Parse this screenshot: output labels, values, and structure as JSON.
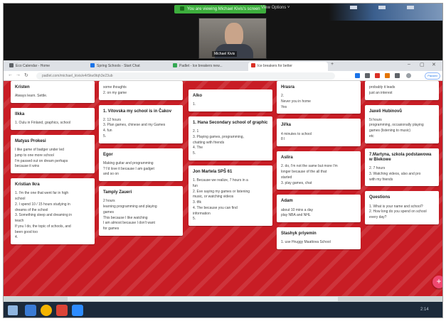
{
  "zoom": {
    "share_status": "You are viewing Michael Kivis's screen",
    "view_options": "View Options ˅",
    "participant_name": "Michael Kivis"
  },
  "browser": {
    "tabs": [
      {
        "label": "Eco Calendar - Home",
        "color": "#5f6368"
      },
      {
        "label": "Spring Schools - Start Chat",
        "color": "#1a73e8"
      },
      {
        "label": "Padlet - Ice breakers new...",
        "color": "#34a853"
      },
      {
        "label": "Ice breakers for better",
        "color": "#d93025"
      }
    ],
    "new_tab": "+",
    "url": "padlet.com/michael_kivis/e4r5kw9tqh3e23ub",
    "profile_label": "Paused",
    "extension_colors": [
      "#1a73e8",
      "#5f6368",
      "#d93025",
      "#e37400",
      "#5f6368"
    ]
  },
  "columns": [
    {
      "cards": [
        {
          "title": "Kristen",
          "lines": [
            "Always learn. Settle."
          ]
        },
        {
          "title": "Ilkka",
          "lines": [
            "1. Oulu in Finland, graphics, school"
          ]
        },
        {
          "title": "Matyas Prokesi",
          "lines": [
            "I like game of badger under led",
            "jump to one more school",
            "I'm passed out on dream perhaps",
            "because it wins"
          ]
        },
        {
          "title": "Kristian Ikra",
          "lines": [
            "1. I'm the one that went far in high",
            "school",
            "2. I spend 10 / 15 hours studying in",
            "dreams of the school",
            "3. Something sleep and dreaming in",
            "teach",
            "If you I do, the topic of schools, and",
            "been good too",
            "4."
          ]
        }
      ]
    },
    {
      "cards": [
        {
          "title": "",
          "lines": [
            "some thoughts",
            "2. on my game"
          ]
        },
        {
          "title": "1. Vítovska my school is in Čakov",
          "lines": [
            "2. 12 hours",
            "3. Plan games, chinese and my Games",
            "4. fun",
            "5."
          ]
        },
        {
          "title": "Egor",
          "lines": [
            "Making guitar and programming",
            "? I'd love it because I am gadget",
            "and so on"
          ]
        },
        {
          "title": "Tamply Zaueri",
          "lines": [
            "2 hours",
            "learning programming and playing",
            "games",
            "This because I like watching",
            "I am almost because I don't want",
            "for games"
          ]
        }
      ]
    },
    {
      "cards": [
        {
          "title": "Alko",
          "lines": [
            "1."
          ]
        },
        {
          "title": "1. Hana Secondary school of graphic",
          "lines": [
            "2. 1",
            "3. Playing games, programming,",
            "chatting with friends",
            "4. The",
            "5."
          ]
        },
        {
          "title": "Jon Martela SPŠ 61",
          "lines": [
            "1. Because we realize, 7 hours in a",
            "fun",
            "2. Eve saying my games or listening",
            "music, or watching videos",
            "3. tfik",
            "4. The because you can find",
            "information",
            "5."
          ]
        }
      ]
    },
    {
      "cards": [
        {
          "title": "Hrasra",
          "lines": [
            "2.",
            "Never you in home",
            "Yes"
          ]
        },
        {
          "title": "Jiřka",
          "lines": [
            "4 minutes to school",
            "8 I"
          ]
        },
        {
          "title": "Aslira",
          "lines": [
            "2. do, I'm not the same but more I'm",
            "longer because of the all that",
            "started",
            "3. play games, chat"
          ]
        },
        {
          "title": "Adam",
          "lines": [
            "about 10 mins a day",
            "play NBA and NHL"
          ]
        },
        {
          "title": "Stashyk priyemin",
          "lines": [
            "1. use Hruggy Maattova School"
          ]
        }
      ]
    },
    {
      "cards": [
        {
          "title": "",
          "lines": [
            "probably it leads",
            "just an interest"
          ]
        },
        {
          "title": "Jaxeli Hubinovů",
          "lines": [
            "5i hours",
            "programming, occasionally playing",
            "games (listening to music)",
            "etc"
          ]
        },
        {
          "title": "7.Martyna, szkola podstawowa w Blekowe",
          "lines": [
            "2. 7 hours",
            "3. Watching videos, also and pro",
            "with my friends"
          ]
        },
        {
          "title": "Questions",
          "lines": [
            "1. What is your name and school?",
            "2. How long do you spend on school",
            "every day?"
          ]
        }
      ]
    }
  ],
  "fab_label": "+",
  "taskbar": {
    "tray_time": "2:14",
    "app_colors": [
      "#3a7bd5",
      "#f4b400",
      "#db4437",
      "#2d8cff"
    ]
  }
}
